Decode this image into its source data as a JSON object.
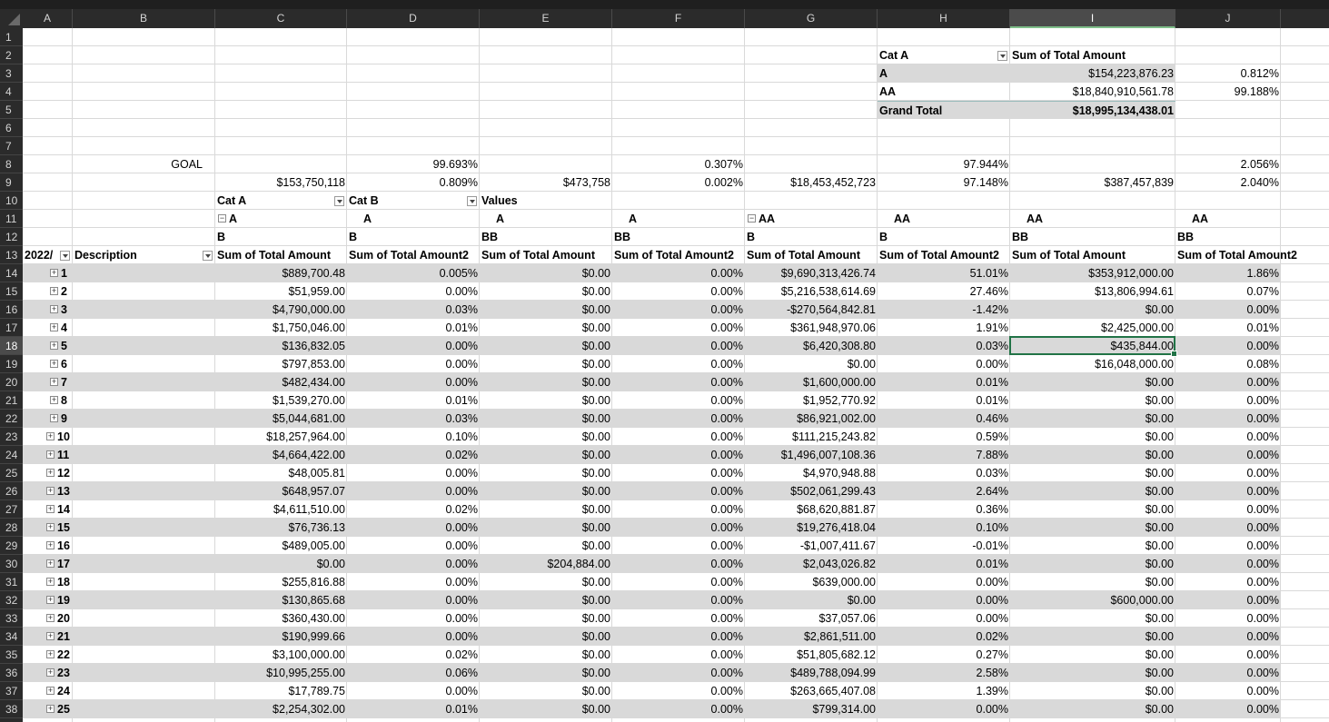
{
  "sheet": {
    "columns": [
      "A",
      "B",
      "C",
      "D",
      "E",
      "F",
      "G",
      "H",
      "I",
      "J"
    ],
    "selected_column": "I",
    "selected_row": 18,
    "rows": [
      1,
      2,
      3,
      4,
      5,
      6,
      7,
      8,
      9,
      10,
      11,
      12,
      13,
      14,
      15,
      16,
      17,
      18,
      19,
      20,
      21,
      22,
      23,
      24,
      25,
      26,
      27,
      28,
      29,
      30,
      31,
      32,
      33,
      34,
      35,
      36,
      37,
      38
    ]
  },
  "pivot1": {
    "header_field": "Cat A",
    "header_value": "Sum of Total Amount",
    "rows": [
      {
        "label": "A",
        "value": "$154,223,876.23",
        "pct": "0.812%"
      },
      {
        "label": "AA",
        "value": "$18,840,910,561.78",
        "pct": "99.188%"
      }
    ],
    "grand_total_label": "Grand Total",
    "grand_total_value": "$18,995,134,438.01"
  },
  "summary": {
    "goal_label": "GOAL",
    "row8": {
      "D": "99.693%",
      "F": "0.307%",
      "H": "97.944%",
      "J": "2.056%"
    },
    "row9": {
      "C": "$153,750,118",
      "D": "0.809%",
      "E": "$473,758",
      "F": "0.002%",
      "G": "$18,453,452,723",
      "H": "97.148%",
      "I": "$387,457,839",
      "J": "2.040%"
    }
  },
  "pivot2": {
    "row10": {
      "C": "Cat A",
      "D": "Cat B",
      "E": "Values"
    },
    "row11": {
      "C": "A",
      "D": "A",
      "E": "A",
      "F": "A",
      "G": "AA",
      "H": "AA",
      "I": "AA",
      "J": "AA"
    },
    "row12": {
      "C": "B",
      "D": "B",
      "E": "BB",
      "F": "BB",
      "G": "B",
      "H": "B",
      "I": "BB",
      "J": "BB"
    },
    "row13": {
      "A": "2022/",
      "B": "Description",
      "C": "Sum of Total Amount",
      "D": "Sum of Total Amount2",
      "E": "Sum of Total Amount",
      "F": "Sum of Total Amount2",
      "G": "Sum of Total Amount",
      "H": "Sum of Total Amount2",
      "I": "Sum of Total Amount",
      "J": "Sum of Total Amount2"
    },
    "data": [
      [
        "1",
        "$889,700.48",
        "0.005%",
        "$0.00",
        "0.00%",
        "$9,690,313,426.74",
        "51.01%",
        "$353,912,000.00",
        "1.86%"
      ],
      [
        "2",
        "$51,959.00",
        "0.00%",
        "$0.00",
        "0.00%",
        "$5,216,538,614.69",
        "27.46%",
        "$13,806,994.61",
        "0.07%"
      ],
      [
        "3",
        "$4,790,000.00",
        "0.03%",
        "$0.00",
        "0.00%",
        "-$270,564,842.81",
        "-1.42%",
        "$0.00",
        "0.00%"
      ],
      [
        "4",
        "$1,750,046.00",
        "0.01%",
        "$0.00",
        "0.00%",
        "$361,948,970.06",
        "1.91%",
        "$2,425,000.00",
        "0.01%"
      ],
      [
        "5",
        "$136,832.05",
        "0.00%",
        "$0.00",
        "0.00%",
        "$6,420,308.80",
        "0.03%",
        "$435,844.00",
        "0.00%"
      ],
      [
        "6",
        "$797,853.00",
        "0.00%",
        "$0.00",
        "0.00%",
        "$0.00",
        "0.00%",
        "$16,048,000.00",
        "0.08%"
      ],
      [
        "7",
        "$482,434.00",
        "0.00%",
        "$0.00",
        "0.00%",
        "$1,600,000.00",
        "0.01%",
        "$0.00",
        "0.00%"
      ],
      [
        "8",
        "$1,539,270.00",
        "0.01%",
        "$0.00",
        "0.00%",
        "$1,952,770.92",
        "0.01%",
        "$0.00",
        "0.00%"
      ],
      [
        "9",
        "$5,044,681.00",
        "0.03%",
        "$0.00",
        "0.00%",
        "$86,921,002.00",
        "0.46%",
        "$0.00",
        "0.00%"
      ],
      [
        "10",
        "$18,257,964.00",
        "0.10%",
        "$0.00",
        "0.00%",
        "$111,215,243.82",
        "0.59%",
        "$0.00",
        "0.00%"
      ],
      [
        "11",
        "$4,664,422.00",
        "0.02%",
        "$0.00",
        "0.00%",
        "$1,496,007,108.36",
        "7.88%",
        "$0.00",
        "0.00%"
      ],
      [
        "12",
        "$48,005.81",
        "0.00%",
        "$0.00",
        "0.00%",
        "$4,970,948.88",
        "0.03%",
        "$0.00",
        "0.00%"
      ],
      [
        "13",
        "$648,957.07",
        "0.00%",
        "$0.00",
        "0.00%",
        "$502,061,299.43",
        "2.64%",
        "$0.00",
        "0.00%"
      ],
      [
        "14",
        "$4,611,510.00",
        "0.02%",
        "$0.00",
        "0.00%",
        "$68,620,881.87",
        "0.36%",
        "$0.00",
        "0.00%"
      ],
      [
        "15",
        "$76,736.13",
        "0.00%",
        "$0.00",
        "0.00%",
        "$19,276,418.04",
        "0.10%",
        "$0.00",
        "0.00%"
      ],
      [
        "16",
        "$489,005.00",
        "0.00%",
        "$0.00",
        "0.00%",
        "-$1,007,411.67",
        "-0.01%",
        "$0.00",
        "0.00%"
      ],
      [
        "17",
        "$0.00",
        "0.00%",
        "$204,884.00",
        "0.00%",
        "$2,043,026.82",
        "0.01%",
        "$0.00",
        "0.00%"
      ],
      [
        "18",
        "$255,816.88",
        "0.00%",
        "$0.00",
        "0.00%",
        "$639,000.00",
        "0.00%",
        "$0.00",
        "0.00%"
      ],
      [
        "19",
        "$130,865.68",
        "0.00%",
        "$0.00",
        "0.00%",
        "$0.00",
        "0.00%",
        "$600,000.00",
        "0.00%"
      ],
      [
        "20",
        "$360,430.00",
        "0.00%",
        "$0.00",
        "0.00%",
        "$37,057.06",
        "0.00%",
        "$0.00",
        "0.00%"
      ],
      [
        "21",
        "$190,999.66",
        "0.00%",
        "$0.00",
        "0.00%",
        "$2,861,511.00",
        "0.02%",
        "$0.00",
        "0.00%"
      ],
      [
        "22",
        "$3,100,000.00",
        "0.02%",
        "$0.00",
        "0.00%",
        "$51,805,682.12",
        "0.27%",
        "$0.00",
        "0.00%"
      ],
      [
        "23",
        "$10,995,255.00",
        "0.06%",
        "$0.00",
        "0.00%",
        "$489,788,094.99",
        "2.58%",
        "$0.00",
        "0.00%"
      ],
      [
        "24",
        "$17,789.75",
        "0.00%",
        "$0.00",
        "0.00%",
        "$263,665,407.08",
        "1.39%",
        "$0.00",
        "0.00%"
      ],
      [
        "25",
        "$2,254,302.00",
        "0.01%",
        "$0.00",
        "0.00%",
        "$799,314.00",
        "0.00%",
        "$0.00",
        "0.00%"
      ]
    ]
  }
}
